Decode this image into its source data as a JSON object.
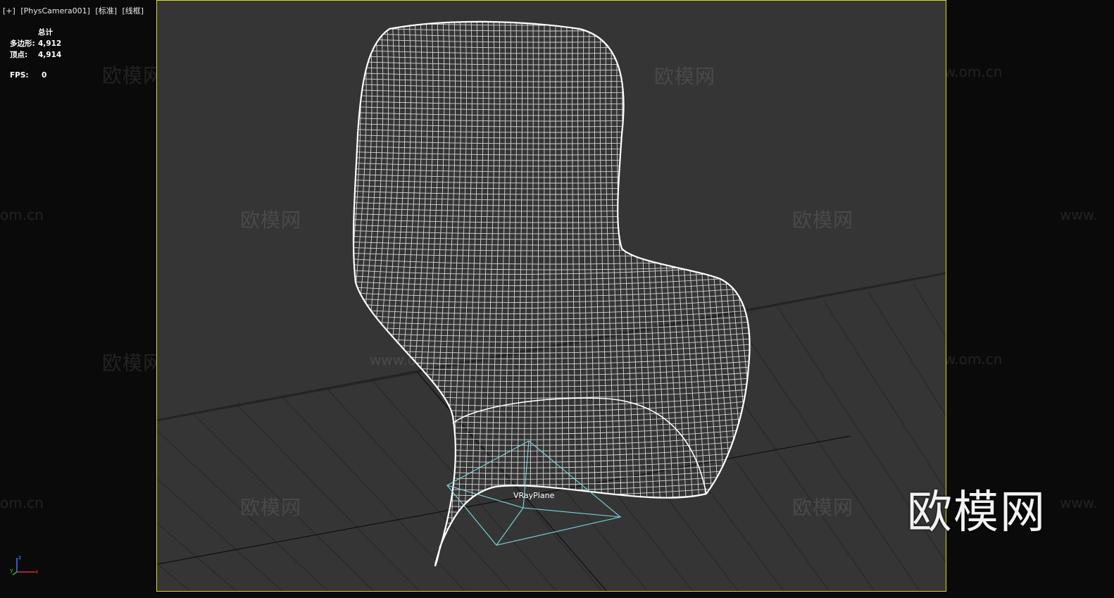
{
  "viewport_header": {
    "plus_label": "[+]",
    "camera_label": "[PhysCamera001]",
    "shading_mode": "[标准]",
    "display_mode": "[线框]"
  },
  "stats": {
    "header": "总计",
    "polygons_label": "多边形:",
    "polygons_value": "4,912",
    "vertices_label": "顶点:",
    "vertices_value": "4,914",
    "fps_label": "FPS:",
    "fps_value": "0"
  },
  "scene": {
    "object_label": "VRayPlane"
  },
  "watermarks": {
    "cn": "欧模网",
    "url": "www.om.cn",
    "url_partial_left": "om.cn",
    "url_partial_right": "www.",
    "logo": "欧模网"
  },
  "axis": {
    "z": "z",
    "x": "x",
    "y": "y"
  },
  "colors": {
    "viewport_bg": "#353535",
    "viewport_border": "#d8d820",
    "wireframe": "#ffffff",
    "vray_plane": "#7fd9e0",
    "grid": "#262626"
  }
}
